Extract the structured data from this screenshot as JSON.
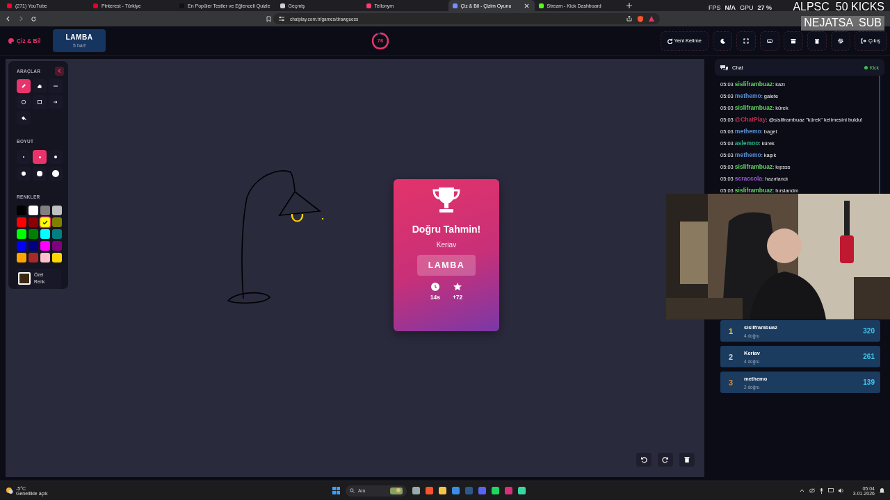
{
  "browser": {
    "tabs": [
      {
        "title": "(271) YouTube",
        "color": "#ff0033",
        "selected": false
      },
      {
        "title": "Pinterest - Türkiye",
        "color": "#e60023",
        "selected": false
      },
      {
        "title": "En Popüler Testler ve Eğlenceli Quizle",
        "color": "#111111",
        "selected": false
      },
      {
        "title": "Geçmiş",
        "color": "#cfcfcf",
        "selected": false
      },
      {
        "title": "Tellonym",
        "color": "#ff3b6b",
        "selected": false
      },
      {
        "title": "Çiz & Bil - Çizim Oyunu",
        "color": "#7a8cff",
        "selected": true
      },
      {
        "title": "Stream - Kick Dashboard",
        "color": "#53fc18",
        "selected": false
      }
    ],
    "url": "chatplay.com.tr/games/drawguess"
  },
  "stream_overlay": {
    "stats": [
      {
        "label": "FPS",
        "value": "N/A"
      },
      {
        "label": "GPU",
        "value": "27 %"
      }
    ],
    "alerts": [
      "ALPSC  50 KICKS",
      "NEJATSA  SUB"
    ]
  },
  "app": {
    "logo": "Çiz & Bil",
    "word": "LAMBA",
    "word_hint": "5 harf",
    "timer": {
      "value": "76",
      "level": 0.93
    },
    "buttons": [
      {
        "kind": "new-word",
        "label": "Yeni Kelime"
      },
      {
        "kind": "theme"
      },
      {
        "kind": "fullscreen"
      },
      {
        "kind": "keyboard"
      },
      {
        "kind": "archive"
      },
      {
        "kind": "trash"
      },
      {
        "kind": "settings"
      },
      {
        "kind": "exit",
        "label": "Çıkış"
      }
    ]
  },
  "toolbox": {
    "title": "ARAÇLAR",
    "tools": [
      {
        "kind": "pencil",
        "selected": true
      },
      {
        "kind": "eraser",
        "selected": false
      },
      {
        "kind": "line",
        "selected": false
      },
      {
        "kind": "circle",
        "selected": false
      },
      {
        "kind": "square",
        "selected": false
      },
      {
        "kind": "arrow",
        "selected": false
      },
      {
        "kind": "fill",
        "selected": false
      }
    ],
    "size_title": "BOYUT",
    "sizes": [
      {
        "selected": false
      },
      {
        "selected": true
      },
      {
        "selected": false
      },
      {
        "selected": false
      },
      {
        "selected": false
      },
      {
        "selected": false
      }
    ],
    "colors_title": "RENKLER",
    "colors": [
      {
        "color": "#000000",
        "selected": false
      },
      {
        "color": "#ffffff",
        "selected": false
      },
      {
        "color": "#808080",
        "selected": false
      },
      {
        "color": "#c0c0c0",
        "selected": false
      },
      {
        "color": "#ff0000",
        "selected": false
      },
      {
        "color": "#8b0000",
        "selected": false
      },
      {
        "color": "#ffff00",
        "selected": true
      },
      {
        "color": "#808000",
        "selected": false
      },
      {
        "color": "#00ff00",
        "selected": false
      },
      {
        "color": "#008000",
        "selected": false
      },
      {
        "color": "#00ffff",
        "selected": false
      },
      {
        "color": "#008080",
        "selected": false
      },
      {
        "color": "#0000ff",
        "selected": false
      },
      {
        "color": "#000080",
        "selected": false
      },
      {
        "color": "#ff00ff",
        "selected": false
      },
      {
        "color": "#800080",
        "selected": false
      },
      {
        "color": "#ffa500",
        "selected": false
      },
      {
        "color": "#a52a2a",
        "selected": false
      },
      {
        "color": "#ffc0cb",
        "selected": false
      },
      {
        "color": "#ffd700",
        "selected": false
      }
    ],
    "custom_color": {
      "label": "Özel Renk",
      "color": "#3a2810"
    }
  },
  "result": {
    "title": "Doğru Tahmin!",
    "player": "Keriav",
    "word": "LAMBA",
    "stats": [
      {
        "kind": "time",
        "value": "14s"
      },
      {
        "kind": "points",
        "value": "+72"
      }
    ]
  },
  "canvas_actions": [
    {
      "kind": "undo"
    },
    {
      "kind": "redo"
    },
    {
      "kind": "clear"
    }
  ],
  "chat": {
    "title": "Chat",
    "source": "Kick",
    "messages": [
      {
        "time": "05:03",
        "user": "sisliframbuaz",
        "color": "#5fd35f",
        "text": ": kazı"
      },
      {
        "time": "05:03",
        "user": "methemo",
        "color": "#5b8fd6",
        "text": ": galete"
      },
      {
        "time": "05:03",
        "user": "sisliframbuaz",
        "color": "#5fd35f",
        "text": ": kürek"
      },
      {
        "time": "05:03",
        "user": "@ChatPlay",
        "color": "#c0304a",
        "text": ": @sisliframbuaz \"kürek\" kelimesini buldu!"
      },
      {
        "time": "05:03",
        "user": "methemo",
        "color": "#5b8fd6",
        "text": ": baget"
      },
      {
        "time": "05:03",
        "user": "aslemoo",
        "color": "#2bb58a",
        "text": ": kürek"
      },
      {
        "time": "05:03",
        "user": "methemo",
        "color": "#5b8fd6",
        "text": ": kaşık"
      },
      {
        "time": "05:03",
        "user": "sisliframbuaz",
        "color": "#5fd35f",
        "text": ": kıpsss"
      },
      {
        "time": "05:03",
        "user": "scraccola",
        "color": "#9a5bd6",
        "text": ": hazırlandı"
      },
      {
        "time": "05:03",
        "user": "sisliframbuaz",
        "color": "#5fd35f",
        "text": ": hırslandm"
      }
    ]
  },
  "leaderboard": [
    {
      "rank": "1",
      "color": "#f5c542",
      "name": "sisliframbuaz",
      "detail": "4 doğru",
      "score": "320"
    },
    {
      "rank": "2",
      "color": "#d0d6e0",
      "name": "Keriav",
      "detail": "4 doğru",
      "score": "261"
    },
    {
      "rank": "3",
      "color": "#e08a3c",
      "name": "methemo",
      "detail": "2 doğru",
      "score": "139"
    }
  ],
  "taskbar": {
    "weather": {
      "temp": "-5°C",
      "text": "Genellikle açık"
    },
    "search": "Ara",
    "time": "05:04",
    "date": "3.01.2026"
  }
}
